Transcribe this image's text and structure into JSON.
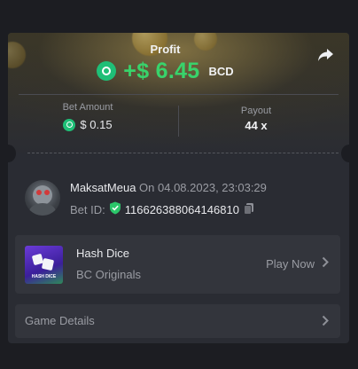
{
  "header": {
    "profit_label": "Profit",
    "profit_amount": "+$ 6.45",
    "profit_currency": "BCD"
  },
  "stats": {
    "bet_amount_label": "Bet Amount",
    "bet_amount_value": "$ 0.15",
    "payout_label": "Payout",
    "payout_value": "44 x"
  },
  "user": {
    "name": "MaksatMeua",
    "date_text": "On 04.08.2023, 23:03:29",
    "bet_id_label": "Bet ID:",
    "bet_id": "116626388064146810"
  },
  "game": {
    "thumb_text": "HASH DICE",
    "name": "Hash Dice",
    "provider": "BC Originals",
    "play_label": "Play Now"
  },
  "details": {
    "label": "Game Details"
  },
  "colors": {
    "profit_green": "#38d36b",
    "bcd_badge": "#1fbf77",
    "card_bg": "#2a2c33"
  },
  "icons": [
    "share-icon",
    "bcd-coin-icon",
    "verified-shield-icon",
    "copy-icon",
    "chevron-right-icon"
  ]
}
